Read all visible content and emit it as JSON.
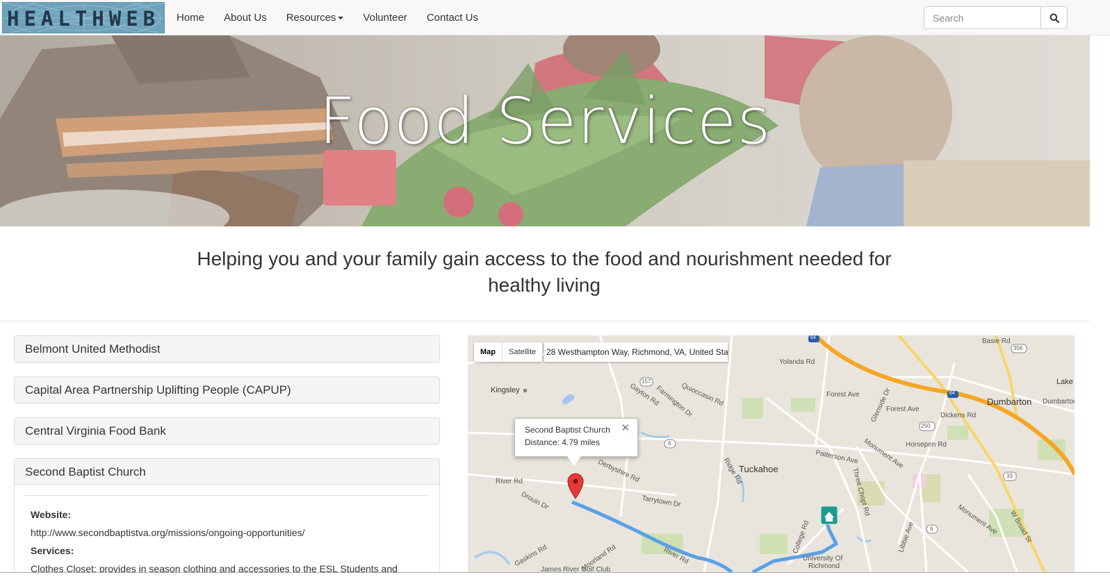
{
  "brand": {
    "logo_text": "HEALTHWEB"
  },
  "nav": {
    "items": [
      {
        "label": "Home"
      },
      {
        "label": "About Us"
      },
      {
        "label": "Resources"
      },
      {
        "label": "Volunteer"
      },
      {
        "label": "Contact Us"
      }
    ]
  },
  "search": {
    "placeholder": "Search"
  },
  "hero": {
    "title": "Food Services"
  },
  "tagline": "Helping you and your family gain access to the food and nourishment needed for healthy living",
  "accordion": {
    "panels": [
      {
        "title": "Belmont United Methodist"
      },
      {
        "title": "Capital Area Partnership Uplifting People (CAPUP)"
      },
      {
        "title": "Central Virginia Food Bank"
      },
      {
        "title": "Second Baptist Church",
        "website_label": "Website:",
        "website": "http://www.secondbaptistva.org/missions/ongoing-opportunities/",
        "services_label": "Services:",
        "services_text": "Clothes Closet: provides in season clothing and accessories to the ESL Students and"
      }
    ]
  },
  "map": {
    "type_map": "Map",
    "type_satellite": "Satellite",
    "address": "28 Westhampton Way, Richmond, VA, United Sta...",
    "info_name": "Second Baptist Church",
    "info_distance": "Distance: 4.79 miles",
    "labels": {
      "kingsley": "Kingsley",
      "tuckahoe": "Tuckahoe",
      "dumbarton": "Dumbarton",
      "dumbarton2": "Dumbarton",
      "lake": "Lake",
      "university": "University Of",
      "richmond": "Richmond",
      "golf": "James River Golf Club",
      "forest_ave": "Forest Ave",
      "forest_ave2": "Forest Ave",
      "basie_rd": "Basie Rd",
      "dickens_rd": "Dickens Rd",
      "horsepen_rd": "Horsepen Rd",
      "patterson_ave": "Patterson Ave",
      "monument_ave": "Monument Ave",
      "monument_ave2": "Monument Ave",
      "river_rd": "River Rd",
      "river_rd2": "River Rd",
      "drouin_dr": "Drouin Dr",
      "tarrytown_dr": "Tarrytown Dr",
      "derbyshire_rd": "Derbyshire Rd",
      "gayton_rd": "Gayton Rd",
      "quioccasin_rd": "Quioccasin Rd",
      "farmington_dr": "Farmington Dr",
      "yolanda_rd": "Yolanda Rd",
      "ridge_rd": "Ridge Rd",
      "w_broad_st": "W Broad St",
      "gaskins_rd": "Gaskins Rd",
      "moorland_rd": "Moorland Rd",
      "college_rd": "College Rd",
      "libbie_ave": "Libbie Ave",
      "glenside_dr": "Glenside Dr",
      "three_chopt_rd": "Three Chopt Rd",
      "shield_157": "157",
      "shield_6": "6",
      "shield_6b": "6",
      "shield_250": "250",
      "shield_33": "33",
      "shield_356": "356",
      "shield_64": "64",
      "shield_64b": "64"
    }
  },
  "colors": {
    "navbar_bg": "#f8f8f8",
    "logo_bg": "#6ea3bb",
    "panel_heading_bg": "#f5f5f5",
    "route_blue": "#5aa0e6",
    "highway_orange": "#f5a623",
    "road_yellow": "#f7d56a",
    "marker_red": "#e53935",
    "home_marker_teal": "#1f9b8c"
  }
}
